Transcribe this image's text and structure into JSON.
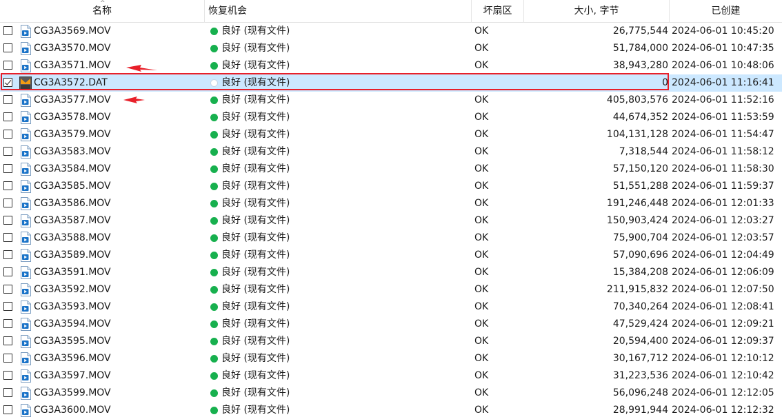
{
  "columns": {
    "name": "名称",
    "recovery": "恢复机会",
    "bad_sectors": "坏扇区",
    "size": "大小, 字节",
    "created": "已创建"
  },
  "colors": {
    "good_status": "#17b04e",
    "selected_row": "#cce8ff",
    "highlight_box": "#e8202a",
    "arrow": "#e8202a"
  },
  "icons": {
    "mov": "video-file-icon",
    "dat": "dat-file-icon",
    "sort": "sort-ascending-icon"
  },
  "rows": [
    {
      "name": "CG3A3569.MOV",
      "type": "mov",
      "status": "良好 (现有文件)",
      "bad": "OK",
      "size": "26,775,544",
      "created": "2024-06-01 10:45:20",
      "checked": false,
      "selected": false
    },
    {
      "name": "CG3A3570.MOV",
      "type": "mov",
      "status": "良好 (现有文件)",
      "bad": "OK",
      "size": "51,784,000",
      "created": "2024-06-01 10:47:35",
      "checked": false,
      "selected": false
    },
    {
      "name": "CG3A3571.MOV",
      "type": "mov",
      "status": "良好 (现有文件)",
      "bad": "OK",
      "size": "38,943,280",
      "created": "2024-06-01 10:48:06",
      "checked": false,
      "selected": false
    },
    {
      "name": "CG3A3572.DAT",
      "type": "dat",
      "status": "良好 (现有文件)",
      "bad": "",
      "size": "0",
      "created": "2024-06-01 11:16:41",
      "checked": true,
      "selected": true
    },
    {
      "name": "CG3A3577.MOV",
      "type": "mov",
      "status": "良好 (现有文件)",
      "bad": "OK",
      "size": "405,803,576",
      "created": "2024-06-01 11:52:16",
      "checked": false,
      "selected": false
    },
    {
      "name": "CG3A3578.MOV",
      "type": "mov",
      "status": "良好 (现有文件)",
      "bad": "OK",
      "size": "44,674,352",
      "created": "2024-06-01 11:53:59",
      "checked": false,
      "selected": false
    },
    {
      "name": "CG3A3579.MOV",
      "type": "mov",
      "status": "良好 (现有文件)",
      "bad": "OK",
      "size": "104,131,128",
      "created": "2024-06-01 11:54:47",
      "checked": false,
      "selected": false
    },
    {
      "name": "CG3A3583.MOV",
      "type": "mov",
      "status": "良好 (现有文件)",
      "bad": "OK",
      "size": "7,318,544",
      "created": "2024-06-01 11:58:12",
      "checked": false,
      "selected": false
    },
    {
      "name": "CG3A3584.MOV",
      "type": "mov",
      "status": "良好 (现有文件)",
      "bad": "OK",
      "size": "57,150,120",
      "created": "2024-06-01 11:58:30",
      "checked": false,
      "selected": false
    },
    {
      "name": "CG3A3585.MOV",
      "type": "mov",
      "status": "良好 (现有文件)",
      "bad": "OK",
      "size": "51,551,288",
      "created": "2024-06-01 11:59:37",
      "checked": false,
      "selected": false
    },
    {
      "name": "CG3A3586.MOV",
      "type": "mov",
      "status": "良好 (现有文件)",
      "bad": "OK",
      "size": "191,246,448",
      "created": "2024-06-01 12:01:33",
      "checked": false,
      "selected": false
    },
    {
      "name": "CG3A3587.MOV",
      "type": "mov",
      "status": "良好 (现有文件)",
      "bad": "OK",
      "size": "150,903,424",
      "created": "2024-06-01 12:03:27",
      "checked": false,
      "selected": false
    },
    {
      "name": "CG3A3588.MOV",
      "type": "mov",
      "status": "良好 (现有文件)",
      "bad": "OK",
      "size": "75,900,704",
      "created": "2024-06-01 12:03:57",
      "checked": false,
      "selected": false
    },
    {
      "name": "CG3A3589.MOV",
      "type": "mov",
      "status": "良好 (现有文件)",
      "bad": "OK",
      "size": "57,090,696",
      "created": "2024-06-01 12:04:49",
      "checked": false,
      "selected": false
    },
    {
      "name": "CG3A3591.MOV",
      "type": "mov",
      "status": "良好 (现有文件)",
      "bad": "OK",
      "size": "15,384,208",
      "created": "2024-06-01 12:06:09",
      "checked": false,
      "selected": false
    },
    {
      "name": "CG3A3592.MOV",
      "type": "mov",
      "status": "良好 (现有文件)",
      "bad": "OK",
      "size": "211,915,832",
      "created": "2024-06-01 12:07:50",
      "checked": false,
      "selected": false
    },
    {
      "name": "CG3A3593.MOV",
      "type": "mov",
      "status": "良好 (现有文件)",
      "bad": "OK",
      "size": "70,340,264",
      "created": "2024-06-01 12:08:41",
      "checked": false,
      "selected": false
    },
    {
      "name": "CG3A3594.MOV",
      "type": "mov",
      "status": "良好 (现有文件)",
      "bad": "OK",
      "size": "47,529,424",
      "created": "2024-06-01 12:09:21",
      "checked": false,
      "selected": false
    },
    {
      "name": "CG3A3595.MOV",
      "type": "mov",
      "status": "良好 (现有文件)",
      "bad": "OK",
      "size": "20,594,400",
      "created": "2024-06-01 12:09:37",
      "checked": false,
      "selected": false
    },
    {
      "name": "CG3A3596.MOV",
      "type": "mov",
      "status": "良好 (现有文件)",
      "bad": "OK",
      "size": "30,167,712",
      "created": "2024-06-01 12:10:12",
      "checked": false,
      "selected": false
    },
    {
      "name": "CG3A3597.MOV",
      "type": "mov",
      "status": "良好 (现有文件)",
      "bad": "OK",
      "size": "31,223,536",
      "created": "2024-06-01 12:10:42",
      "checked": false,
      "selected": false
    },
    {
      "name": "CG3A3599.MOV",
      "type": "mov",
      "status": "良好 (现有文件)",
      "bad": "OK",
      "size": "56,096,248",
      "created": "2024-06-01 12:12:05",
      "checked": false,
      "selected": false
    },
    {
      "name": "CG3A3600.MOV",
      "type": "mov",
      "status": "良好 (现有文件)",
      "bad": "OK",
      "size": "28,991,944",
      "created": "2024-06-01 12:12:32",
      "checked": false,
      "selected": false
    }
  ]
}
